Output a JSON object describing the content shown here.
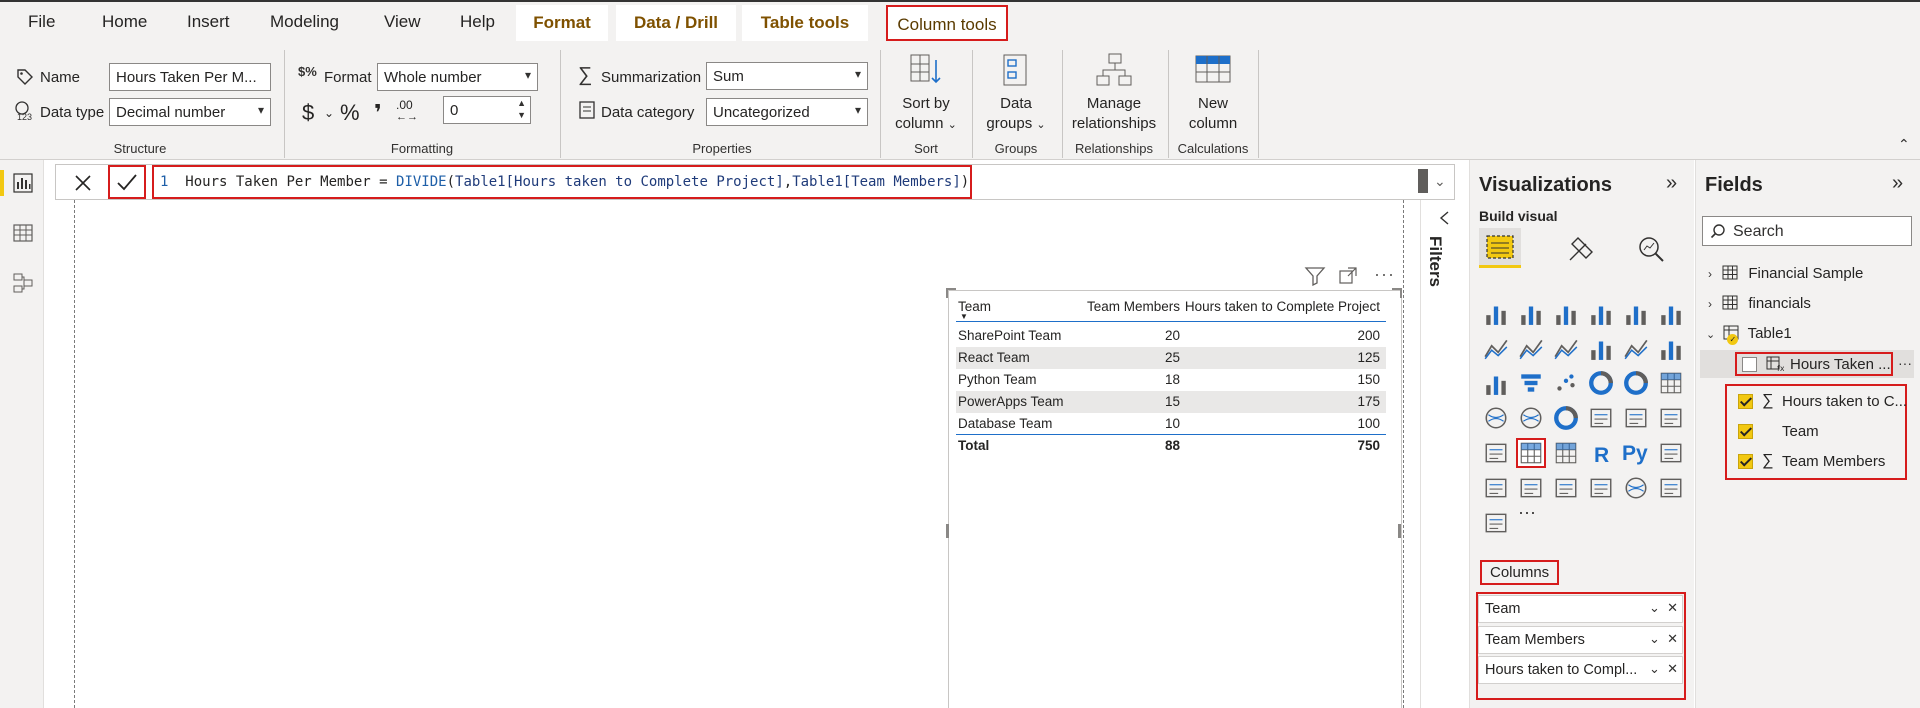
{
  "menubar": {
    "items": [
      "File",
      "Home",
      "Insert",
      "Modeling",
      "View",
      "Help"
    ],
    "context_tabs": [
      "Format",
      "Data / Drill",
      "Table tools",
      "Column tools"
    ]
  },
  "ribbon": {
    "structure": {
      "name_label": "Name",
      "name_value": "Hours Taken Per M...",
      "datatype_label": "Data type",
      "datatype_value": "Decimal number",
      "title": "Structure"
    },
    "formatting": {
      "format_label": "Format",
      "format_value": "Whole number",
      "currency_symbol": "$",
      "percent_symbol": "%",
      "comma_symbol": "❜",
      "decimal_symbol": ".00",
      "decimals_value": "0",
      "title": "Formatting"
    },
    "properties": {
      "summarization_label": "Summarization",
      "summarization_value": "Sum",
      "category_label": "Data category",
      "category_value": "Uncategorized",
      "title": "Properties"
    },
    "sort": {
      "label_line1": "Sort by",
      "label_line2": "column",
      "title": "Sort"
    },
    "groups": {
      "label_line1": "Data",
      "label_line2": "groups",
      "title": "Groups"
    },
    "relationships": {
      "label_line1": "Manage",
      "label_line2": "relationships",
      "title": "Relationships"
    },
    "calculations": {
      "label_line1": "New",
      "label_line2": "column",
      "title": "Calculations"
    }
  },
  "formula": {
    "line_number": "1",
    "prefix": "Hours Taken Per Member = ",
    "function": "DIVIDE",
    "arg1": "Table1[Hours taken to Complete Project]",
    "arg2": "Table1[Team Members]"
  },
  "table_visual": {
    "headers": [
      "Team",
      "Team Members",
      "Hours taken to Complete Project"
    ],
    "rows": [
      [
        "SharePoint Team",
        "20",
        "200"
      ],
      [
        "React Team",
        "25",
        "125"
      ],
      [
        "Python Team",
        "18",
        "150"
      ],
      [
        "PowerApps Team",
        "15",
        "175"
      ],
      [
        "Database Team",
        "10",
        "100"
      ]
    ],
    "total": [
      "Total",
      "88",
      "750"
    ]
  },
  "filters": {
    "label": "Filters"
  },
  "visualizations": {
    "title": "Visualizations",
    "build_visual": "Build visual",
    "columns_label": "Columns",
    "wells": [
      "Team",
      "Team Members",
      "Hours taken to Compl..."
    ],
    "r_label": "R",
    "py_label": "Py",
    "more_label": "···"
  },
  "fields": {
    "title": "Fields",
    "search_placeholder": "Search",
    "tables": [
      "Financial Sample",
      "financials",
      "Table1"
    ],
    "table1_fields": [
      {
        "label": "Hours Taken ...",
        "checked": false
      },
      {
        "label": "Hours taken to C...",
        "checked": true
      },
      {
        "label": "Team",
        "checked": true
      },
      {
        "label": "Team Members",
        "checked": true
      }
    ],
    "more_label": "···"
  },
  "colors": {
    "accent_red": "#d61c1c",
    "powerbi_yellow": "#f2c811",
    "ctx_tab_text": "#7f5100",
    "pane_bg": "#f3f2f1"
  }
}
